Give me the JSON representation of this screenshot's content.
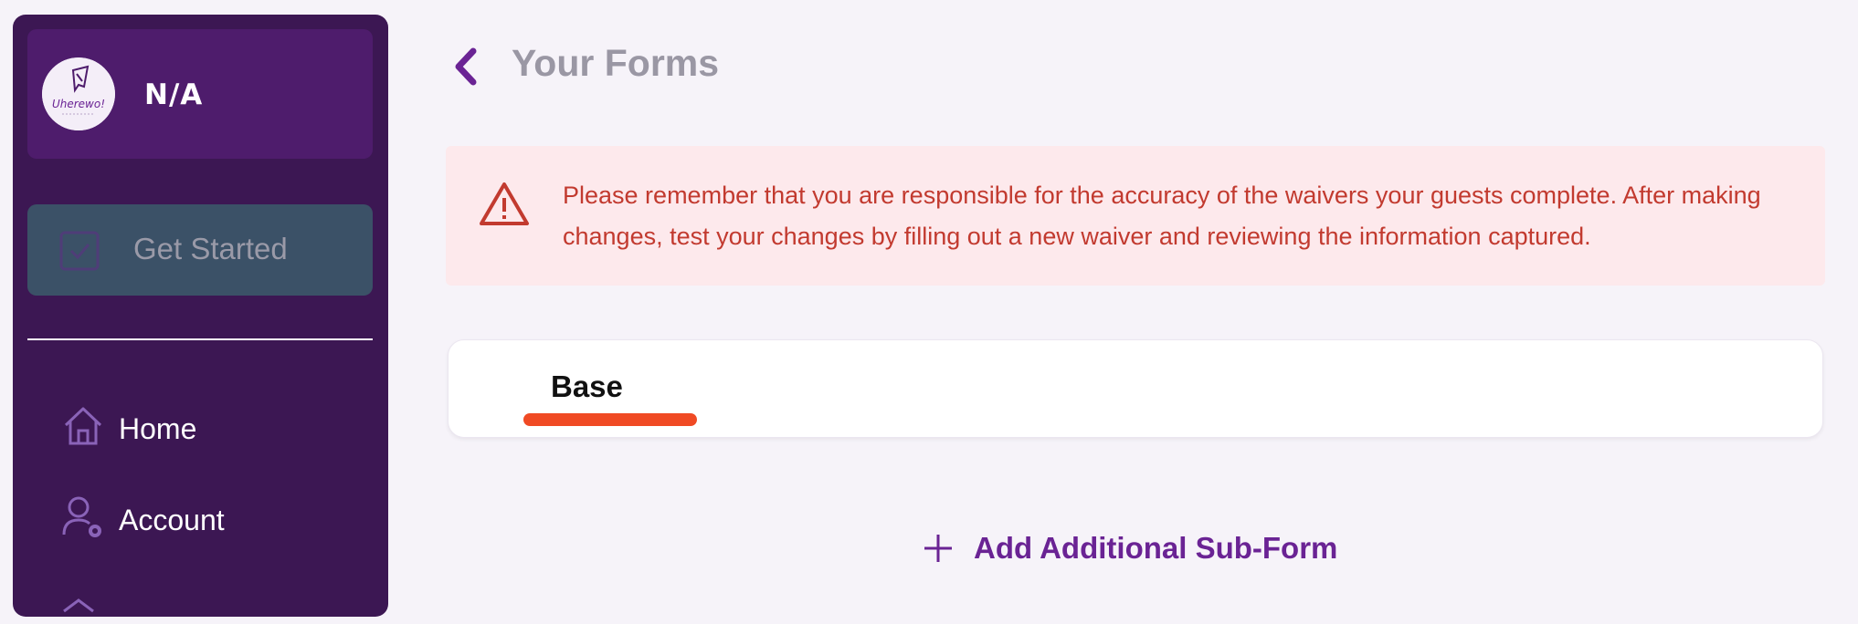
{
  "sidebar": {
    "profile": {
      "name": "N/A",
      "logo_text": "Uherewo!"
    },
    "get_started": {
      "label": "Get Started"
    },
    "nav": [
      {
        "label": "Home",
        "icon": "home-icon"
      },
      {
        "label": "Account",
        "icon": "user-gear-icon"
      }
    ]
  },
  "header": {
    "back_icon": "chevron-left-icon",
    "title": "Your Forms"
  },
  "alert": {
    "icon": "warning-triangle-icon",
    "text": "Please remember that you are responsible for the accuracy of the waivers your guests complete. After making changes, test your changes by filling out a new waiver and reviewing the information captured."
  },
  "forms": [
    {
      "name": "Base"
    }
  ],
  "actions": {
    "add_subform": "Add Additional Sub-Form",
    "add_icon": "plus-icon"
  },
  "colors": {
    "sidebar_bg": "#3c1753",
    "profile_bg": "#4e1c6c",
    "get_started_bg": "#3b5167",
    "accent_purple": "#6a2394",
    "alert_bg": "#fde9ec",
    "alert_text": "#c23a2f",
    "underline": "#f04a24"
  }
}
